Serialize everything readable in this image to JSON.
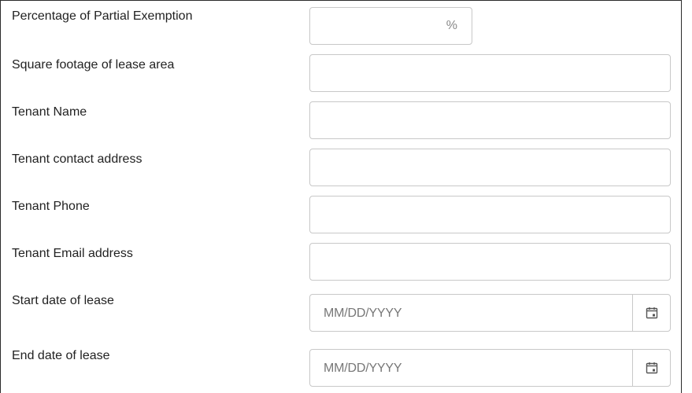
{
  "form": {
    "percentage_partial_exemption": {
      "label": "Percentage of Partial Exemption",
      "value": "",
      "suffix": "%"
    },
    "square_footage": {
      "label": "Square footage of lease area",
      "value": ""
    },
    "tenant_name": {
      "label": "Tenant Name",
      "value": ""
    },
    "tenant_contact_address": {
      "label": "Tenant contact address",
      "value": ""
    },
    "tenant_phone": {
      "label": "Tenant Phone",
      "value": ""
    },
    "tenant_email": {
      "label": "Tenant Email address",
      "value": ""
    },
    "start_date": {
      "label": "Start date of lease",
      "placeholder": "MM/DD/YYYY",
      "value": ""
    },
    "end_date": {
      "label": "End date of lease",
      "placeholder": "MM/DD/YYYY",
      "value": ""
    }
  },
  "icons": {
    "calendar": "calendar-icon"
  },
  "colors": {
    "border": "#c8c8c8",
    "frame": "#2b2b2b",
    "placeholder": "#777777",
    "label": "#222222"
  }
}
